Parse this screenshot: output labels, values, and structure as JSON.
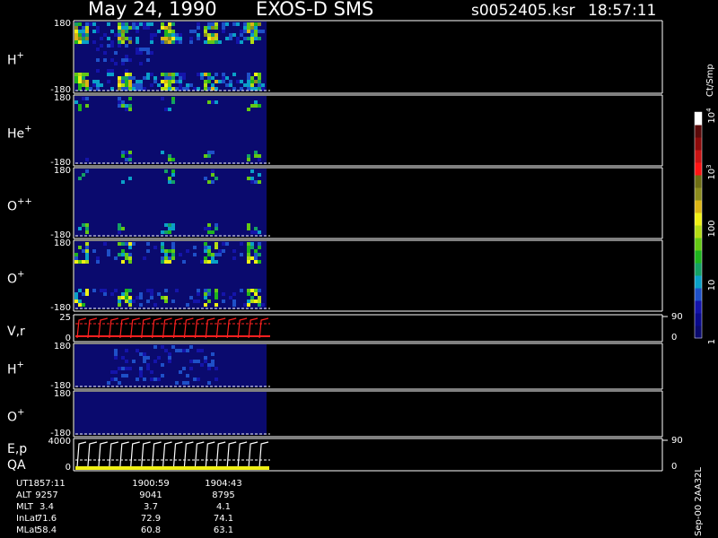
{
  "header": {
    "date": "May 24, 1990",
    "instrument": "EXOS-D SMS",
    "file": "s0052405.ksr",
    "time": "18:57:11"
  },
  "colorbar": {
    "unit": "Ct/Smp",
    "labels": [
      {
        "text": "1",
        "value": 1
      },
      {
        "text": "10",
        "value": 10
      },
      {
        "text": "100",
        "value": 100
      },
      {
        "text": "10",
        "sup": "3",
        "value": 1000
      },
      {
        "text": "10",
        "sup": "4",
        "value": 10000
      }
    ],
    "colors": [
      "#0a0a6e",
      "#0a0a8c",
      "#1414aa",
      "#1e50c8",
      "#0aa0c8",
      "#14a064",
      "#1eb41e",
      "#64c814",
      "#b4dc14",
      "#f0f014",
      "#dcb414",
      "#8c8c1e",
      "#6e6e14",
      "#ff1414",
      "#c81414",
      "#8c0a0a",
      "#5a0a0a",
      "#ffffff"
    ]
  },
  "chart_data": {
    "type": "heatmap",
    "time_axis": {
      "start": "18:57:11",
      "data_end": "19:05:42",
      "plot_end": "19:30:00"
    },
    "panels": [
      {
        "label": "H",
        "sup": "+",
        "ymin": "-180",
        "ymax": "180",
        "ylim": [
          -180,
          180
        ],
        "intensity": "high"
      },
      {
        "label": "He",
        "sup": "+",
        "ymin": "-180",
        "ymax": "180",
        "ylim": [
          -180,
          180
        ],
        "intensity": "low"
      },
      {
        "label": "O",
        "sup": "++",
        "ymin": "-180",
        "ymax": "180",
        "ylim": [
          -180,
          180
        ],
        "intensity": "low"
      },
      {
        "label": "O",
        "sup": "+",
        "ymin": "-180",
        "ymax": "180",
        "ylim": [
          -180,
          180
        ],
        "intensity": "medium"
      },
      {
        "label": "V,r",
        "sup": "",
        "ymin": "0",
        "ymax": "25",
        "ylim": [
          0,
          25
        ],
        "kind": "line",
        "right_min": "0",
        "right_max": "90"
      },
      {
        "label": "H",
        "sup": "+",
        "ymin": "-180",
        "ymax": "180",
        "ylim": [
          -180,
          180
        ],
        "intensity": "sparse"
      },
      {
        "label": "O",
        "sup": "+",
        "ymin": "-180",
        "ymax": "180",
        "ylim": [
          -180,
          180
        ],
        "intensity": "none"
      },
      {
        "label": "E,p",
        "sup": "",
        "label2": "QA",
        "ymin": "0",
        "ymax": "4000",
        "ylim": [
          0,
          4000
        ],
        "kind": "line",
        "right_min": "0",
        "right_max": "90"
      }
    ],
    "ephemeris": {
      "rows": [
        {
          "name": "UT",
          "values": [
            "1857:11",
            "1900:59",
            "1904:43"
          ]
        },
        {
          "name": "ALT",
          "values": [
            "9257",
            "9041",
            "8795"
          ]
        },
        {
          "name": "MLT",
          "values": [
            "3.4",
            "3.7",
            "4.1"
          ]
        },
        {
          "name": "InLat",
          "values": [
            "71.6",
            "72.9",
            "74.1"
          ]
        },
        {
          "name": "MLat",
          "values": [
            "58.4",
            "60.8",
            "63.1"
          ]
        }
      ]
    }
  },
  "footer": {
    "stamp": "Sep-00 2AA32L"
  }
}
